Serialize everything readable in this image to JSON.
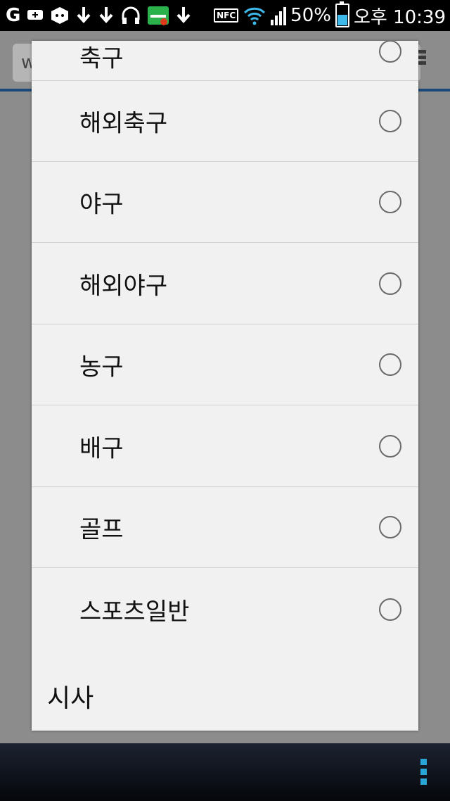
{
  "status_bar": {
    "battery_percent": "50%",
    "time": "오후 10:39",
    "nfc_label": "NFC",
    "left_icons": [
      "g-icon",
      "chat-plus-icon",
      "hexagon-icon",
      "download-icon",
      "download-icon",
      "headphones-icon",
      "naver-icon",
      "download-icon"
    ]
  },
  "background_page": {
    "address_partial": "w"
  },
  "dialog": {
    "partial_top_label": "축구",
    "options": [
      {
        "label": "해외축구",
        "selected": false
      },
      {
        "label": "야구",
        "selected": false
      },
      {
        "label": "해외야구",
        "selected": false
      },
      {
        "label": "농구",
        "selected": false
      },
      {
        "label": "배구",
        "selected": false
      },
      {
        "label": "골프",
        "selected": false
      },
      {
        "label": "스포츠일반",
        "selected": false
      }
    ],
    "next_section": "시사"
  },
  "nav_bar": {
    "buttons": [
      "recent-apps-icon",
      "home-icon",
      "back-icon",
      "menu-icon"
    ]
  },
  "colors": {
    "dialog_bg": "#f1f1f1",
    "accent": "#2aa6d6"
  }
}
